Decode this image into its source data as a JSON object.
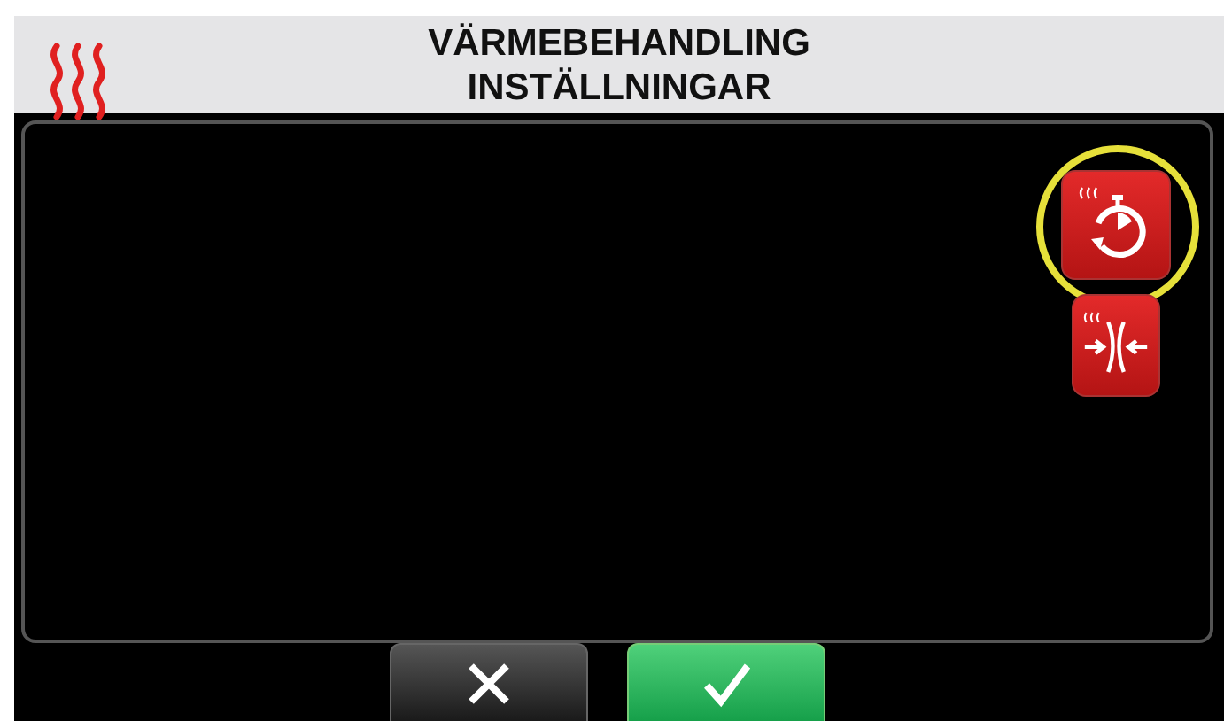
{
  "header": {
    "title_lines": [
      "VÄRMEBEHANDLING",
      "INSTÄLLNINGAR"
    ]
  },
  "tools": [
    {
      "kind": "timer",
      "highlighted": true
    },
    {
      "kind": "press",
      "highlighted": false
    }
  ],
  "footer_buttons": [
    {
      "kind": "cancel"
    },
    {
      "kind": "confirm"
    }
  ]
}
